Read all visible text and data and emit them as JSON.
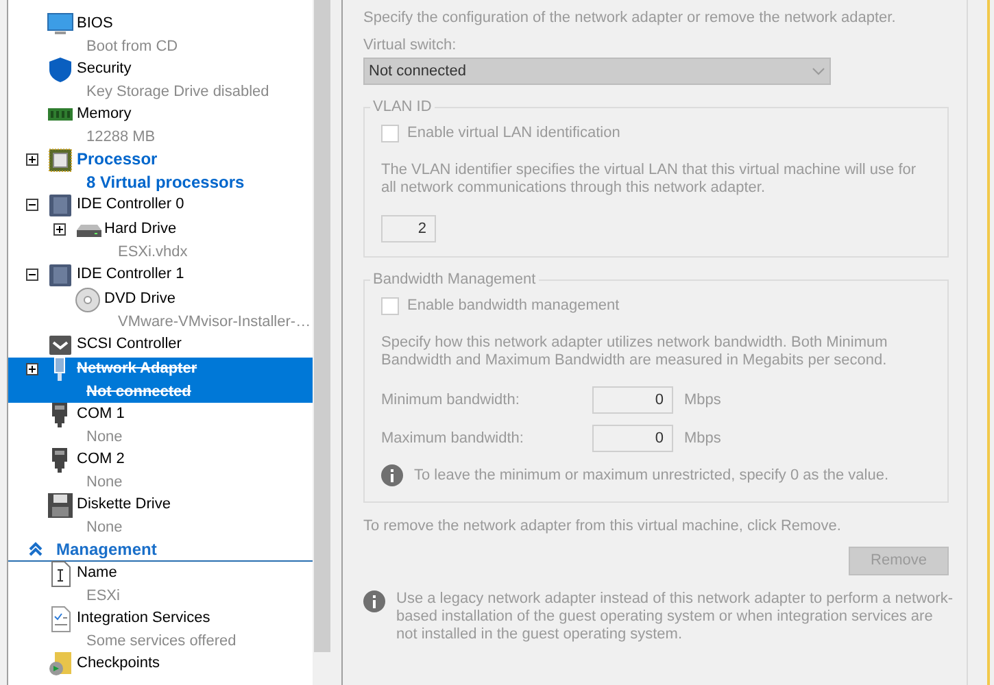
{
  "hardware": [
    {
      "kind": "bios",
      "name": "BIOS",
      "detail": "Boot from CD",
      "selected": false,
      "modified": false,
      "removed": false
    },
    {
      "kind": "shield",
      "name": "Security",
      "detail": "Key Storage Drive disabled",
      "selected": false,
      "modified": false,
      "removed": false
    },
    {
      "kind": "memory",
      "name": "Memory",
      "detail": "12288 MB",
      "selected": false,
      "modified": false,
      "removed": false
    },
    {
      "kind": "chip",
      "name": "Processor",
      "detail": "8 Virtual processors",
      "expanded": false,
      "selected": false,
      "modified": true,
      "removed": false
    },
    {
      "kind": "controller",
      "name": "IDE Controller 0",
      "expanded": true,
      "selected": false,
      "modified": false,
      "removed": false,
      "children": [
        {
          "kind": "disk",
          "name": "Hard Drive",
          "detail": "ESXi.vhdx",
          "expanded": false,
          "selected": false,
          "modified": false,
          "removed": false
        }
      ]
    },
    {
      "kind": "controller",
      "name": "IDE Controller 1",
      "expanded": true,
      "selected": false,
      "modified": false,
      "removed": false,
      "children": [
        {
          "kind": "dvd",
          "name": "DVD Drive",
          "detail": "VMware-VMvisor-Installer-…",
          "selected": false,
          "modified": false,
          "removed": false
        }
      ]
    },
    {
      "kind": "scsi",
      "name": "SCSI Controller",
      "selected": false,
      "modified": false,
      "removed": false
    },
    {
      "kind": "network",
      "name": "Network Adapter",
      "detail": "Not connected",
      "expanded": false,
      "selected": true,
      "modified": false,
      "removed": true
    },
    {
      "kind": "port",
      "name": "COM 1",
      "detail": "None",
      "selected": false,
      "modified": false,
      "removed": false
    },
    {
      "kind": "port",
      "name": "COM 2",
      "detail": "None",
      "selected": false,
      "modified": false,
      "removed": false
    },
    {
      "kind": "floppy",
      "name": "Diskette Drive",
      "detail": "None",
      "selected": false,
      "modified": false,
      "removed": false
    }
  ],
  "management": {
    "title": "Management",
    "expanded": true,
    "items": [
      {
        "kind": "name",
        "name": "Name",
        "detail": "ESXi",
        "selected": false,
        "modified": false,
        "removed": false
      },
      {
        "kind": "services",
        "name": "Integration Services",
        "detail": "Some services offered",
        "selected": false,
        "modified": false,
        "removed": false
      },
      {
        "kind": "checkpoint",
        "name": "Checkpoints",
        "selected": false,
        "modified": false,
        "removed": false
      }
    ]
  },
  "adapter": {
    "disabled": true,
    "description": "Specify the configuration of the network adapter or remove the network adapter.",
    "virtual_switch": {
      "label": "Virtual switch:",
      "value": "Not connected"
    },
    "vlan": {
      "title": "VLAN ID",
      "checkbox": {
        "label": "Enable virtual LAN identification",
        "checked": false
      },
      "description": "The VLAN identifier specifies the virtual LAN that this virtual machine will use for all network communications through this network adapter.",
      "value": "2"
    },
    "bandwidth": {
      "title": "Bandwidth Management",
      "checkbox": {
        "label": "Enable bandwidth management",
        "checked": false
      },
      "description": "Specify how this network adapter utilizes network bandwidth. Both Minimum Bandwidth and Maximum Bandwidth are measured in Megabits per second.",
      "minimum": {
        "label": "Minimum bandwidth:",
        "value": "0",
        "unit": "Mbps"
      },
      "maximum": {
        "label": "Maximum bandwidth:",
        "value": "0",
        "unit": "Mbps"
      },
      "note": "To leave the minimum or maximum unrestricted, specify 0 as the value."
    },
    "remove_hint": "To remove the network adapter from this virtual machine, click Remove.",
    "remove_button": "Remove",
    "legacy_note": "Use a legacy network adapter instead of this network adapter to perform a network-based installation of the guest operating system or when integration services are not installed in the guest operating system."
  }
}
